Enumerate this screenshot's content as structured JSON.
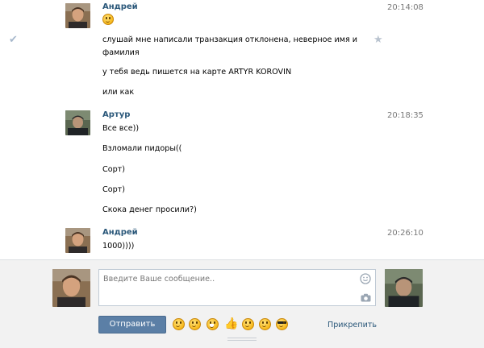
{
  "conversation": {
    "messages": [
      {
        "author": "Андрей",
        "time": "20:14:08",
        "lines": [
          "слушай мне написали транзакция отклонена, неверное имя и",
          "фамилия",
          "у тебя ведь пишется на карте ARTYR KOROVIN",
          "или как"
        ],
        "has_smiley": true
      },
      {
        "author": "Артур",
        "time": "20:18:35",
        "lines": [
          "Все все))",
          "Взломали пидоры((",
          "Сорт)",
          "Сорт)",
          "Скока денег просили?)"
        ]
      },
      {
        "author": "Андрей",
        "time": "20:26:10",
        "lines": [
          "1000))))"
        ]
      }
    ]
  },
  "composer": {
    "placeholder": "Введите Ваше сообщение..",
    "send_label": "Отправить",
    "attach_label": "Прикрепить",
    "emoji": [
      "grin",
      "smile",
      "laugh",
      "thumbs-up",
      "wink",
      "joy",
      "cool"
    ]
  },
  "colors": {
    "name_link": "#2b587a",
    "send_button": "#5b7fa6",
    "composer_bg": "#f2f2f2"
  },
  "icons": {
    "read_check": "check-icon",
    "favorite": "star-icon",
    "emoji_picker": "smiley-icon",
    "photo": "camera-icon"
  }
}
